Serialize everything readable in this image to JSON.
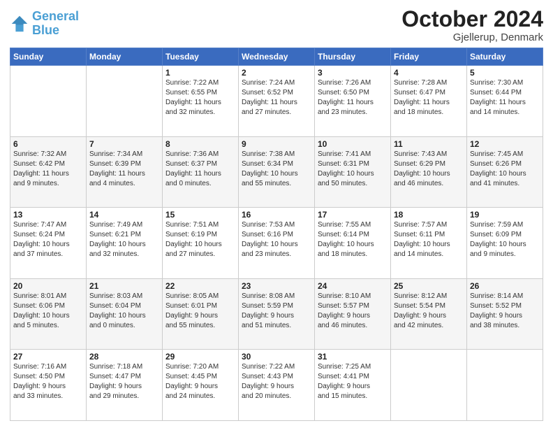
{
  "header": {
    "logo_line1": "General",
    "logo_line2": "Blue",
    "month_title": "October 2024",
    "location": "Gjellerup, Denmark"
  },
  "weekdays": [
    "Sunday",
    "Monday",
    "Tuesday",
    "Wednesday",
    "Thursday",
    "Friday",
    "Saturday"
  ],
  "weeks": [
    [
      {
        "day": "",
        "info": ""
      },
      {
        "day": "",
        "info": ""
      },
      {
        "day": "1",
        "info": "Sunrise: 7:22 AM\nSunset: 6:55 PM\nDaylight: 11 hours\nand 32 minutes."
      },
      {
        "day": "2",
        "info": "Sunrise: 7:24 AM\nSunset: 6:52 PM\nDaylight: 11 hours\nand 27 minutes."
      },
      {
        "day": "3",
        "info": "Sunrise: 7:26 AM\nSunset: 6:50 PM\nDaylight: 11 hours\nand 23 minutes."
      },
      {
        "day": "4",
        "info": "Sunrise: 7:28 AM\nSunset: 6:47 PM\nDaylight: 11 hours\nand 18 minutes."
      },
      {
        "day": "5",
        "info": "Sunrise: 7:30 AM\nSunset: 6:44 PM\nDaylight: 11 hours\nand 14 minutes."
      }
    ],
    [
      {
        "day": "6",
        "info": "Sunrise: 7:32 AM\nSunset: 6:42 PM\nDaylight: 11 hours\nand 9 minutes."
      },
      {
        "day": "7",
        "info": "Sunrise: 7:34 AM\nSunset: 6:39 PM\nDaylight: 11 hours\nand 4 minutes."
      },
      {
        "day": "8",
        "info": "Sunrise: 7:36 AM\nSunset: 6:37 PM\nDaylight: 11 hours\nand 0 minutes."
      },
      {
        "day": "9",
        "info": "Sunrise: 7:38 AM\nSunset: 6:34 PM\nDaylight: 10 hours\nand 55 minutes."
      },
      {
        "day": "10",
        "info": "Sunrise: 7:41 AM\nSunset: 6:31 PM\nDaylight: 10 hours\nand 50 minutes."
      },
      {
        "day": "11",
        "info": "Sunrise: 7:43 AM\nSunset: 6:29 PM\nDaylight: 10 hours\nand 46 minutes."
      },
      {
        "day": "12",
        "info": "Sunrise: 7:45 AM\nSunset: 6:26 PM\nDaylight: 10 hours\nand 41 minutes."
      }
    ],
    [
      {
        "day": "13",
        "info": "Sunrise: 7:47 AM\nSunset: 6:24 PM\nDaylight: 10 hours\nand 37 minutes."
      },
      {
        "day": "14",
        "info": "Sunrise: 7:49 AM\nSunset: 6:21 PM\nDaylight: 10 hours\nand 32 minutes."
      },
      {
        "day": "15",
        "info": "Sunrise: 7:51 AM\nSunset: 6:19 PM\nDaylight: 10 hours\nand 27 minutes."
      },
      {
        "day": "16",
        "info": "Sunrise: 7:53 AM\nSunset: 6:16 PM\nDaylight: 10 hours\nand 23 minutes."
      },
      {
        "day": "17",
        "info": "Sunrise: 7:55 AM\nSunset: 6:14 PM\nDaylight: 10 hours\nand 18 minutes."
      },
      {
        "day": "18",
        "info": "Sunrise: 7:57 AM\nSunset: 6:11 PM\nDaylight: 10 hours\nand 14 minutes."
      },
      {
        "day": "19",
        "info": "Sunrise: 7:59 AM\nSunset: 6:09 PM\nDaylight: 10 hours\nand 9 minutes."
      }
    ],
    [
      {
        "day": "20",
        "info": "Sunrise: 8:01 AM\nSunset: 6:06 PM\nDaylight: 10 hours\nand 5 minutes."
      },
      {
        "day": "21",
        "info": "Sunrise: 8:03 AM\nSunset: 6:04 PM\nDaylight: 10 hours\nand 0 minutes."
      },
      {
        "day": "22",
        "info": "Sunrise: 8:05 AM\nSunset: 6:01 PM\nDaylight: 9 hours\nand 55 minutes."
      },
      {
        "day": "23",
        "info": "Sunrise: 8:08 AM\nSunset: 5:59 PM\nDaylight: 9 hours\nand 51 minutes."
      },
      {
        "day": "24",
        "info": "Sunrise: 8:10 AM\nSunset: 5:57 PM\nDaylight: 9 hours\nand 46 minutes."
      },
      {
        "day": "25",
        "info": "Sunrise: 8:12 AM\nSunset: 5:54 PM\nDaylight: 9 hours\nand 42 minutes."
      },
      {
        "day": "26",
        "info": "Sunrise: 8:14 AM\nSunset: 5:52 PM\nDaylight: 9 hours\nand 38 minutes."
      }
    ],
    [
      {
        "day": "27",
        "info": "Sunrise: 7:16 AM\nSunset: 4:50 PM\nDaylight: 9 hours\nand 33 minutes."
      },
      {
        "day": "28",
        "info": "Sunrise: 7:18 AM\nSunset: 4:47 PM\nDaylight: 9 hours\nand 29 minutes."
      },
      {
        "day": "29",
        "info": "Sunrise: 7:20 AM\nSunset: 4:45 PM\nDaylight: 9 hours\nand 24 minutes."
      },
      {
        "day": "30",
        "info": "Sunrise: 7:22 AM\nSunset: 4:43 PM\nDaylight: 9 hours\nand 20 minutes."
      },
      {
        "day": "31",
        "info": "Sunrise: 7:25 AM\nSunset: 4:41 PM\nDaylight: 9 hours\nand 15 minutes."
      },
      {
        "day": "",
        "info": ""
      },
      {
        "day": "",
        "info": ""
      }
    ]
  ]
}
